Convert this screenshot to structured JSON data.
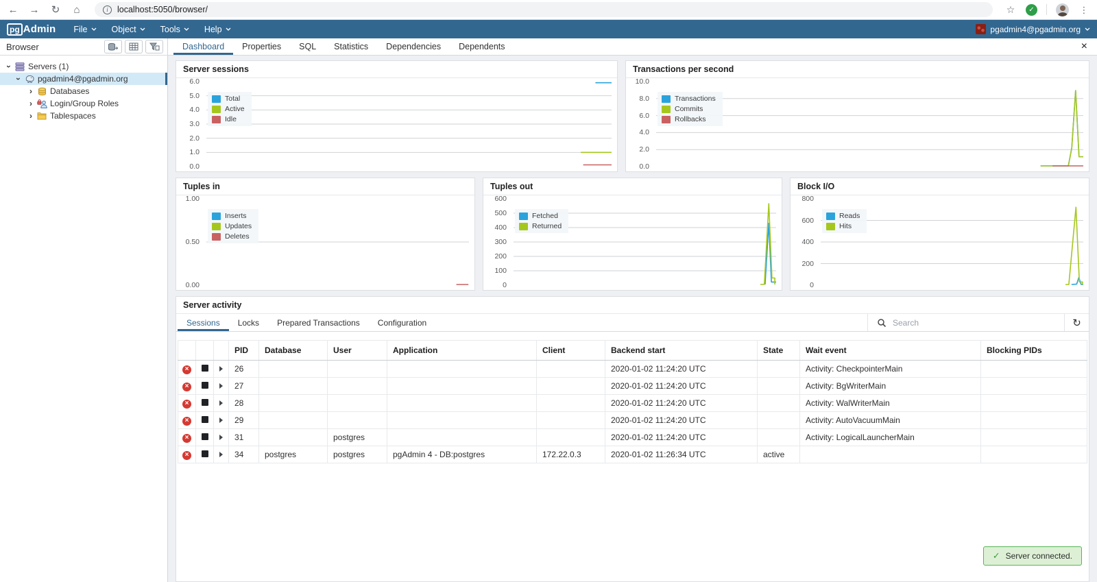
{
  "chrome": {
    "url": "localhost:5050/browser/"
  },
  "app_header": {
    "logo_pg": "pg",
    "logo_admin": "Admin",
    "menus": [
      "File",
      "Object",
      "Tools",
      "Help"
    ],
    "user_email": "pgadmin4@pgadmin.org"
  },
  "sidebar": {
    "title": "Browser",
    "tree": [
      {
        "label": "Servers (1)",
        "icon": "server-group",
        "expanded": true
      },
      {
        "label": "pgadmin4@pgadmin.org",
        "icon": "postgresql-server",
        "expanded": true,
        "selected": true
      },
      {
        "label": "Databases",
        "icon": "databases",
        "expanded": false
      },
      {
        "label": "Login/Group Roles",
        "icon": "login-group-roles",
        "expanded": false
      },
      {
        "label": "Tablespaces",
        "icon": "tablespaces",
        "expanded": false
      }
    ]
  },
  "tabs": {
    "items": [
      "Dashboard",
      "Properties",
      "SQL",
      "Statistics",
      "Dependencies",
      "Dependents"
    ],
    "active": "Dashboard"
  },
  "chart_data": [
    {
      "id": "server-sessions",
      "type": "line",
      "title": "Server sessions",
      "ylim": [
        0,
        6
      ],
      "yticks": [
        "6.0",
        "5.0",
        "4.0",
        "3.0",
        "2.0",
        "1.0",
        "0.0"
      ],
      "legend_position": "top-left",
      "series": [
        {
          "name": "Total",
          "color": "#2aa3dc",
          "points": [
            [
              0.96,
              5.92
            ],
            [
              1,
              5.92
            ]
          ]
        },
        {
          "name": "Active",
          "color": "#a5c71d",
          "points": [
            [
              0.924,
              1.0
            ],
            [
              1,
              1.0
            ]
          ]
        },
        {
          "name": "Idle",
          "color": "#c96161",
          "points": [
            [
              0.93,
              0.12
            ],
            [
              1,
              0.12
            ]
          ]
        }
      ]
    },
    {
      "id": "transactions-per-second",
      "type": "line",
      "title": "Transactions per second",
      "ylim": [
        0,
        10
      ],
      "yticks": [
        "10.0",
        "8.0",
        "6.0",
        "4.0",
        "2.0",
        "0.0"
      ],
      "legend_position": "top-left",
      "series": [
        {
          "name": "Transactions",
          "color": "#2aa3dc",
          "points": [
            [
              0.9,
              0
            ],
            [
              0.965,
              0
            ],
            [
              0.973,
              2.2
            ],
            [
              0.982,
              8.95
            ],
            [
              0.99,
              1.15
            ],
            [
              1,
              1.15
            ]
          ]
        },
        {
          "name": "Commits",
          "color": "#a5c71d",
          "points": [
            [
              0.9,
              0
            ],
            [
              0.965,
              0
            ],
            [
              0.973,
              2.2
            ],
            [
              0.982,
              8.95
            ],
            [
              0.99,
              1.15
            ],
            [
              1,
              1.15
            ]
          ]
        },
        {
          "name": "Rollbacks",
          "color": "#c96161",
          "points": [
            [
              0.928,
              0.07
            ],
            [
              1,
              0.07
            ]
          ]
        }
      ]
    },
    {
      "id": "tuples-in",
      "type": "line",
      "title": "Tuples in",
      "ylim": [
        0,
        1
      ],
      "yticks": [
        "1.00",
        "0.50",
        "0.00"
      ],
      "legend_position": "top-left",
      "series": [
        {
          "name": "Inserts",
          "color": "#2aa3dc",
          "points": []
        },
        {
          "name": "Updates",
          "color": "#a5c71d",
          "points": []
        },
        {
          "name": "Deletes",
          "color": "#c96161",
          "points": [
            [
              0.952,
              0.006
            ],
            [
              0.998,
              0.006
            ]
          ]
        }
      ]
    },
    {
      "id": "tuples-out",
      "type": "line",
      "title": "Tuples out",
      "ylim": [
        0,
        600
      ],
      "yticks": [
        "600",
        "500",
        "400",
        "300",
        "200",
        "100",
        "0"
      ],
      "legend_position": "top-left",
      "series": [
        {
          "name": "Fetched",
          "color": "#2aa3dc",
          "points": [
            [
              0.958,
              0
            ],
            [
              0.972,
              430
            ],
            [
              0.982,
              22
            ],
            [
              1,
              22
            ]
          ]
        },
        {
          "name": "Returned",
          "color": "#a5c71d",
          "points": [
            [
              0.94,
              0
            ],
            [
              0.955,
              6
            ],
            [
              0.972,
              566
            ],
            [
              0.984,
              50
            ],
            [
              0.995,
              50
            ],
            [
              0.995,
              2
            ]
          ]
        }
      ]
    },
    {
      "id": "block-io",
      "type": "line",
      "title": "Block I/O",
      "ylim": [
        0,
        800
      ],
      "yticks": [
        "800",
        "600",
        "400",
        "200",
        "0"
      ],
      "legend_position": "top-left",
      "series": [
        {
          "name": "Reads",
          "color": "#2aa3dc",
          "points": [
            [
              0.955,
              0
            ],
            [
              0.975,
              10
            ],
            [
              0.983,
              72
            ],
            [
              0.992,
              6
            ],
            [
              1,
              6
            ]
          ]
        },
        {
          "name": "Hits",
          "color": "#a5c71d",
          "points": [
            [
              0.932,
              0
            ],
            [
              0.945,
              6
            ],
            [
              0.972,
              722
            ],
            [
              0.985,
              30
            ],
            [
              0.997,
              30
            ],
            [
              0.997,
              4
            ]
          ]
        }
      ]
    }
  ],
  "server_activity": {
    "title": "Server activity",
    "tabs": [
      "Sessions",
      "Locks",
      "Prepared Transactions",
      "Configuration"
    ],
    "active_tab": "Sessions",
    "search_placeholder": "Search",
    "table": {
      "columns": [
        "",
        "",
        "",
        "PID",
        "Database",
        "User",
        "Application",
        "Client",
        "Backend start",
        "State",
        "Wait event",
        "Blocking PIDs"
      ],
      "rows": [
        {
          "pid": "26",
          "database": "",
          "user": "",
          "application": "",
          "client": "",
          "backend_start": "2020-01-02 11:24:20 UTC",
          "state": "",
          "wait_event": "Activity: CheckpointerMain",
          "blocking_pids": ""
        },
        {
          "pid": "27",
          "database": "",
          "user": "",
          "application": "",
          "client": "",
          "backend_start": "2020-01-02 11:24:20 UTC",
          "state": "",
          "wait_event": "Activity: BgWriterMain",
          "blocking_pids": ""
        },
        {
          "pid": "28",
          "database": "",
          "user": "",
          "application": "",
          "client": "",
          "backend_start": "2020-01-02 11:24:20 UTC",
          "state": "",
          "wait_event": "Activity: WalWriterMain",
          "blocking_pids": ""
        },
        {
          "pid": "29",
          "database": "",
          "user": "",
          "application": "",
          "client": "",
          "backend_start": "2020-01-02 11:24:20 UTC",
          "state": "",
          "wait_event": "Activity: AutoVacuumMain",
          "blocking_pids": ""
        },
        {
          "pid": "31",
          "database": "",
          "user": "postgres",
          "application": "",
          "client": "",
          "backend_start": "2020-01-02 11:24:20 UTC",
          "state": "",
          "wait_event": "Activity: LogicalLauncherMain",
          "blocking_pids": ""
        },
        {
          "pid": "34",
          "database": "postgres",
          "user": "postgres",
          "application": "pgAdmin 4 - DB:postgres",
          "client": "172.22.0.3",
          "backend_start": "2020-01-02 11:26:34 UTC",
          "state": "active",
          "wait_event": "",
          "blocking_pids": ""
        }
      ]
    }
  },
  "toast": {
    "message": "Server connected."
  },
  "colors": {
    "header_bg": "#326790",
    "accent": "#326790",
    "selected_tree_bg": "#d2e9f7",
    "toast_border": "#56b456",
    "toast_bg": "#ddf0d5",
    "chart_blue": "#2aa3dc",
    "chart_green": "#a5c71d",
    "chart_red": "#c96161"
  }
}
